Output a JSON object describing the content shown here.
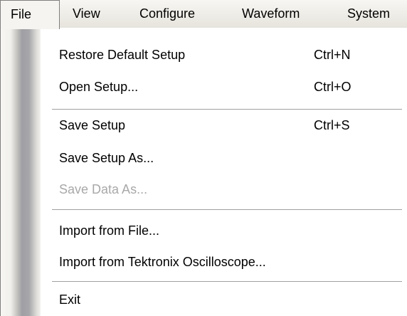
{
  "menubar": {
    "items": [
      {
        "label": "File"
      },
      {
        "label": "View"
      },
      {
        "label": "Configure"
      },
      {
        "label": "Waveform"
      },
      {
        "label": "System"
      }
    ]
  },
  "file_menu": {
    "items": [
      {
        "label": "Restore Default Setup",
        "shortcut": "Ctrl+N",
        "enabled": true
      },
      {
        "label": "Open Setup...",
        "shortcut": "Ctrl+O",
        "enabled": true
      },
      {
        "label": "Save Setup",
        "shortcut": "Ctrl+S",
        "enabled": true
      },
      {
        "label": "Save Setup As...",
        "enabled": true
      },
      {
        "label": "Save Data As...",
        "enabled": false
      },
      {
        "label": "Import from File...",
        "enabled": true
      },
      {
        "label": "Import from Tektronix Oscilloscope...",
        "enabled": true
      },
      {
        "label": "Exit",
        "enabled": true
      }
    ]
  },
  "colors": {
    "disabled_text": "#a8a8a8",
    "separator": "#a0a0a0"
  }
}
